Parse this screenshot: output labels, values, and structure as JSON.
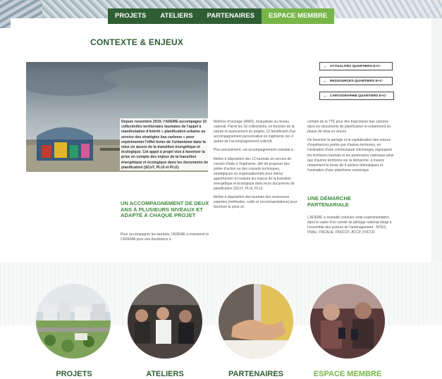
{
  "nav": {
    "items": [
      {
        "label": "PROJETS",
        "style": "dark"
      },
      {
        "label": "ATELIERS",
        "style": "dark"
      },
      {
        "label": "PARTENAIRES",
        "style": "dark"
      },
      {
        "label": "ESPACE MEMBRE",
        "style": "light"
      }
    ]
  },
  "colors": {
    "dark_green": "#2f5e33",
    "light_green": "#77b548",
    "heading_green": "#3f8a3c"
  },
  "section": {
    "title": "CONTEXTE & ENJEUX"
  },
  "photo": {
    "caption": "Depuis novembre 2019, l'ADEME accompagne 16 collectivités territoriales lauréates de l'appel à manifestation d'intérêt « planification urbaine au service des stratégies bas carbone » pour expérimenter l'effet levier de l'urbanisme dans la mise en œuvre de la transition énergétique et écologique. Cet appel à projet vise à favoriser la prise en compte des enjeux de la transition énergétique et écologique dans les documents de planification (SCoT, PLUi et PLU)."
  },
  "columns": {
    "accompagnement_title": "UN ACCOMPAGNEMENT DE DEUX ANS À PLUSIEURS NIVEAUX ET ADAPTÉ À CHAQUE PROJET",
    "accompagnement_text": "Pour accompagner les lauréats, l'ADEME a missionné le CEREMA pour une Assistance à",
    "middle_p1": "Maîtrise d'ouvrage (AMO), mutualisée au niveau national. Parmi les 16 collectivités, en fonction de la nature et avancement du projets, 12 bénéficient d'un accompagnement personnalisé en ingénierie, les 4 autres de l'accompagnement collectif.",
    "middle_p2": "Plus précisément, cet accompagnement consiste à :",
    "middle_p3": "Mettre à disposition des 12 lauréats un service de conseil d'aide à l'ingénierie, afin de proposer des pistes d'action ou des conseils techniques, stratégiques ou organisationnels pour mieux appréhender et traduire les enjeux de la transition énergétique et écologique dans leurs documents de planification (SCoT, PLUi, PLU)",
    "middle_p4": "Mettre à disposition des lauréats des ressources expertes (méthodes, outils et recommandations) pour favoriser la prise en",
    "right_p1": "compte de la TTE pour des trajectoires bas carbone dans les documents de planification et notamment en phase de mise en œuvre",
    "right_p2": "De favoriser le partage et la capitalisation des retours d'expériences portés par d'autres territoires, en l'animation d'une communauté d'échanges regroupant les territoires lauréats et les partenaires nationaux ainsi que d'autres territoires sur la démarche, à travers notamment la tenue de 4 ateliers thématiques et l'animation d'une plateforme numérique",
    "demarche_title": "UNE DÉMARCHE PARTENARIALE",
    "demarche_text": "L'ADEME a souhaité conduire cette expérimentation dans le cadre d'un comité de pilotage national élargi à l'ensemble des acteurs de l'aménagement : MTES, FNAU, FNCAUE, FNSCOT, ACCP, FNCCR"
  },
  "buttons": [
    {
      "label": "ACTUALITÉS QUARTIERS E+C-",
      "icon": "arrow-left-icon"
    },
    {
      "label": "RESSOURCES QUARTIERS E+C-",
      "icon": "arrow-left-icon"
    },
    {
      "label": "CARTOGRAPHIE QUARTIERS E+C-",
      "icon": "arrow-left-icon"
    }
  ],
  "tiles": [
    {
      "label": "PROJETS",
      "image": "aerial-city-photo"
    },
    {
      "label": "ATELIERS",
      "image": "audience-photo"
    },
    {
      "label": "PARTENAIRES",
      "image": "handshake-photo"
    },
    {
      "label": "ESPACE MEMBRE",
      "image": "people-phones-photo"
    }
  ]
}
